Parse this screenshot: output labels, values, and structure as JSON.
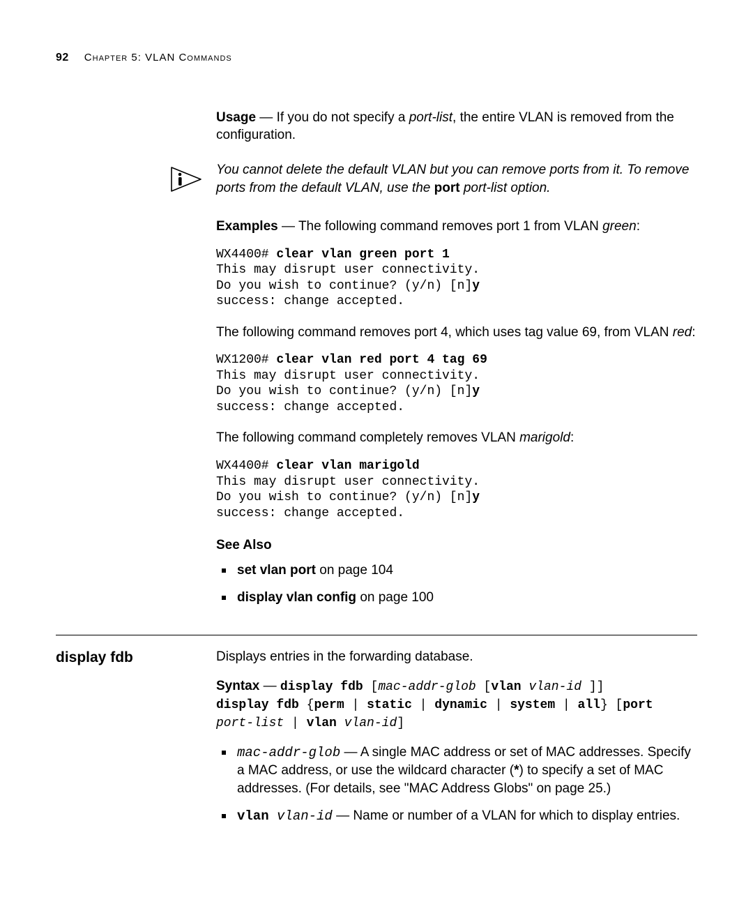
{
  "runhead": {
    "page": "92",
    "chapter_sc": "Chapter 5: VLAN Commands"
  },
  "usage": {
    "label": "Usage",
    "sep": " — ",
    "text_before_italic": "If you do not specify a ",
    "italic": "port-list",
    "text_after_italic": ", the entire VLAN is removed from the configuration."
  },
  "note": {
    "line1": "You cannot delete the default VLAN but you can remove ports from it. To remove ports from the default VLAN, use the ",
    "bold": "port",
    "line2": " port-list ",
    "line3": "option."
  },
  "examples": {
    "label": "Examples",
    "sep": " — ",
    "intro1_a": "The following command removes port 1 from VLAN ",
    "intro1_i": "green",
    "intro1_b": ":",
    "code1_prompt": "WX4400# ",
    "code1_cmd": "clear vlan green port 1",
    "code_body": "This may disrupt user connectivity.\nDo you wish to continue? (y/n) [n]",
    "code_y": "y",
    "code_success": "success: change accepted.",
    "intro2_a": "The following command removes port 4, which uses tag value 69, from VLAN ",
    "intro2_i": "red",
    "intro2_b": ":",
    "code2_prompt": "WX1200# ",
    "code2_cmd": "clear vlan red port 4 tag 69",
    "intro3_a": "The following command completely removes VLAN ",
    "intro3_i": "marigold",
    "intro3_b": ":",
    "code3_prompt": "WX4400# ",
    "code3_cmd": "clear vlan marigold"
  },
  "see_also": {
    "title": "See Also",
    "items": [
      {
        "bold": "set vlan port",
        "rest": " on page 104"
      },
      {
        "bold": "display vlan config",
        "rest": " on page 100"
      }
    ]
  },
  "display_fdb": {
    "heading": "display fdb",
    "lead": "Displays entries in the forwarding database.",
    "syntax_label": "Syntax",
    "syntax_sep": " — ",
    "syntax": {
      "l1_a": "display fdb  ",
      "l1_b": "[",
      "l1_c": "mac-addr-glob",
      "l1_d": "  [",
      "l1_e": "vlan",
      "l1_f": " ",
      "l1_g": "vlan-id",
      "l1_h": " ]]",
      "l2_a": "display fdb ",
      "l2_b": "{",
      "l2_c": "perm",
      "l2_d": " | ",
      "l2_e": "static",
      "l2_f": " | ",
      "l2_g": "dynamic",
      "l2_h": " | ",
      "l2_i": "system",
      "l2_j": " | ",
      "l2_k": "all",
      "l2_l": "} [",
      "l2_m": "port",
      "l3_a": "port-list",
      "l3_b": " | ",
      "l3_c": "vlan",
      "l3_d": " ",
      "l3_e": "vlan-id",
      "l3_f": "]"
    },
    "params": [
      {
        "term_mono_i": "mac-addr-glob",
        "sep": " — ",
        "rest_a": "A single MAC address or set of MAC addresses. Specify a MAC address, or use the wildcard character (",
        "star": "*",
        "rest_b": ") to specify a set of MAC addresses. (For details, see \"MAC Address Globs\" on page 25.)"
      },
      {
        "term_mono_b": "vlan",
        "space": " ",
        "term_mono_i": "vlan-id",
        "sep": " — ",
        "rest_a": "Name or number of a VLAN for which to display entries."
      }
    ]
  }
}
